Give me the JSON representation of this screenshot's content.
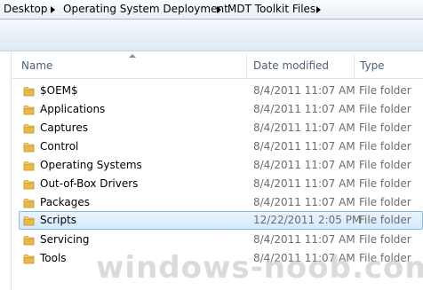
{
  "breadcrumb": [
    "Desktop",
    "Operating System Deployment",
    "MDT Toolkit Files"
  ],
  "columns": {
    "name": "Name",
    "date_modified": "Date modified",
    "type": "Type"
  },
  "files": [
    {
      "name": "$OEM$",
      "date": "8/4/2011 11:07 AM",
      "type": "File folder"
    },
    {
      "name": "Applications",
      "date": "8/4/2011 11:07 AM",
      "type": "File folder"
    },
    {
      "name": "Captures",
      "date": "8/4/2011 11:07 AM",
      "type": "File folder"
    },
    {
      "name": "Control",
      "date": "8/4/2011 11:07 AM",
      "type": "File folder"
    },
    {
      "name": "Operating Systems",
      "date": "8/4/2011 11:07 AM",
      "type": "File folder"
    },
    {
      "name": "Out-of-Box Drivers",
      "date": "8/4/2011 11:07 AM",
      "type": "File folder"
    },
    {
      "name": "Packages",
      "date": "8/4/2011 11:07 AM",
      "type": "File folder"
    },
    {
      "name": "Scripts",
      "date": "12/22/2011 2:05 PM",
      "type": "File folder",
      "selected": true
    },
    {
      "name": "Servicing",
      "date": "8/4/2011 11:07 AM",
      "type": "File folder"
    },
    {
      "name": "Tools",
      "date": "8/4/2011 11:07 AM",
      "type": "File folder"
    }
  ],
  "icons": {
    "folder": "folder-icon",
    "breadcrumb_separator": "chevron-right-icon",
    "sort": "sort-ascending-icon"
  },
  "colors": {
    "selection_border": "#89bde9",
    "selection_fill": "#d5e9fd",
    "folder": "#e8b94a"
  },
  "watermark": "windows-noob.com"
}
